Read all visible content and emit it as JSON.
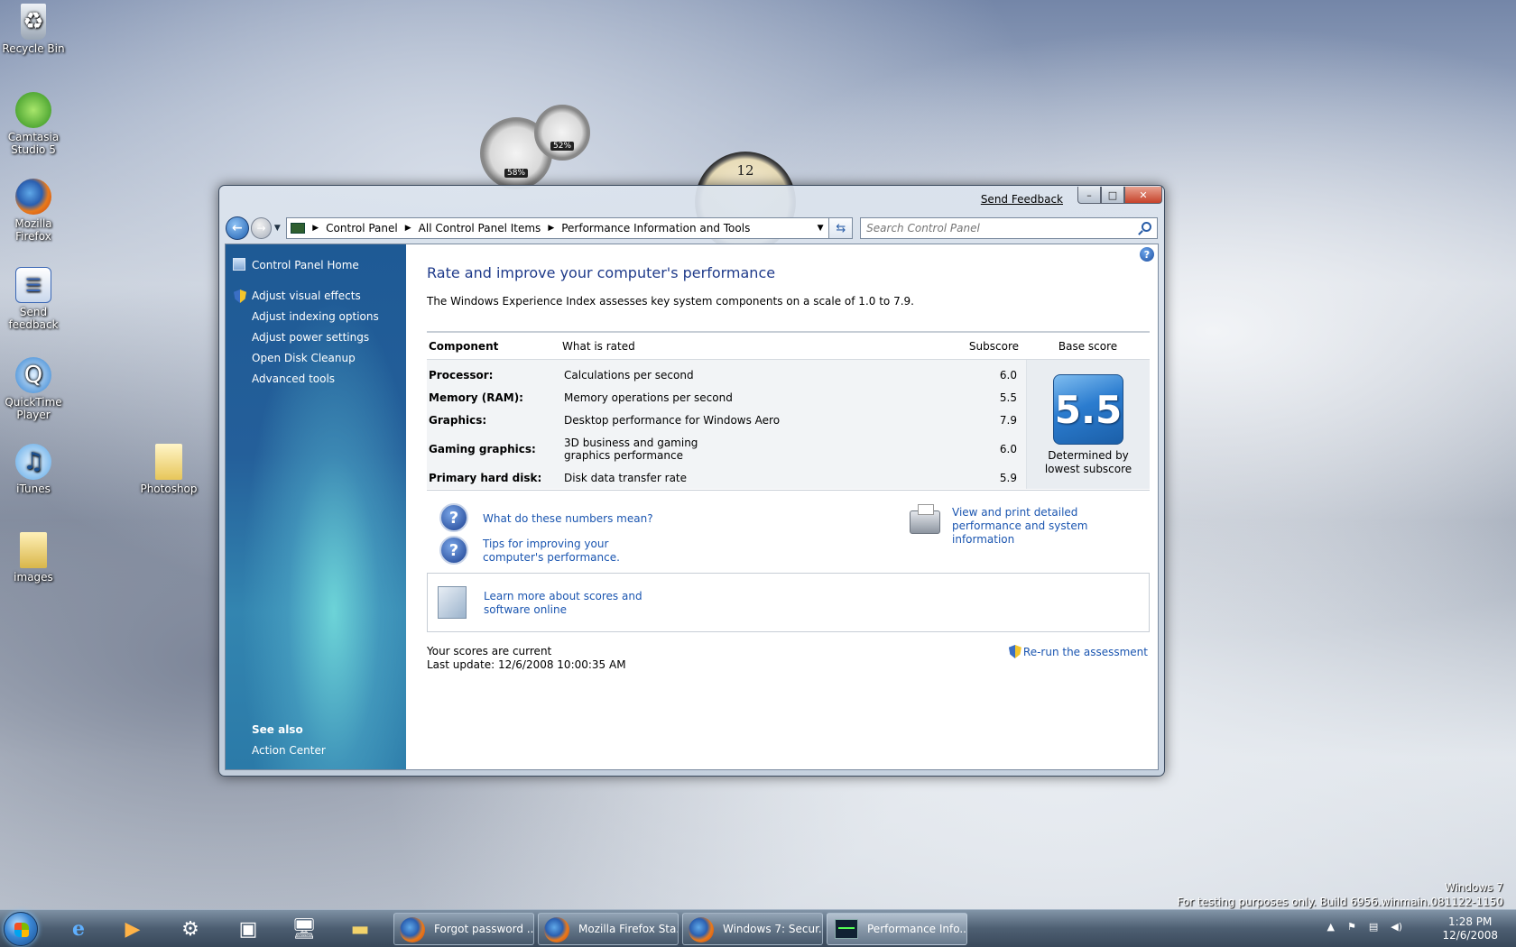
{
  "desktop": {
    "icons": [
      {
        "label": "Recycle Bin",
        "icon": "recycle-bin-icon"
      },
      {
        "label": "Camtasia Studio 5",
        "icon": "camtasia-icon"
      },
      {
        "label": "Mozilla Firefox",
        "icon": "firefox-icon"
      },
      {
        "label": "Send feedback",
        "icon": "feedback-icon"
      },
      {
        "label": "QuickTime Player",
        "icon": "quicktime-icon"
      },
      {
        "label": "iTunes",
        "icon": "itunes-icon"
      },
      {
        "label": "Photoshop",
        "icon": "folder-icon"
      },
      {
        "label": "images",
        "icon": "folder-icon"
      }
    ],
    "gadgets": {
      "cpu_meter_cpu": "58%",
      "cpu_meter_ram": "52%",
      "clock_twelve": "12"
    },
    "watermark": {
      "line1": "Windows 7",
      "line2": "For testing purposes only. Build 6956.winmain.081122-1150"
    }
  },
  "window": {
    "send_feedback": "Send Feedback",
    "controls": {
      "minimize": "–",
      "maximize": "□",
      "close": "✕"
    },
    "breadcrumb": [
      "Control Panel",
      "All Control Panel Items",
      "Performance Information and Tools"
    ],
    "search_placeholder": "Search Control Panel",
    "sidebar": {
      "home": "Control Panel Home",
      "tasks": [
        "Adjust visual effects",
        "Adjust indexing options",
        "Adjust power settings",
        "Open Disk Cleanup",
        "Advanced tools"
      ],
      "see_also": "See also",
      "action_center": "Action Center"
    },
    "content": {
      "title": "Rate and improve your computer's performance",
      "description": "The Windows Experience Index assesses key system components on a scale of 1.0 to 7.9.",
      "table": {
        "headers": {
          "component": "Component",
          "what": "What is rated",
          "subscore": "Subscore",
          "base": "Base score"
        },
        "rows": [
          {
            "component": "Processor:",
            "what": "Calculations per second",
            "subscore": "6.0"
          },
          {
            "component": "Memory (RAM):",
            "what": "Memory operations per second",
            "subscore": "5.5"
          },
          {
            "component": "Graphics:",
            "what": "Desktop performance for Windows Aero",
            "subscore": "7.9"
          },
          {
            "component": "Gaming graphics:",
            "what": "3D business and gaming graphics performance",
            "subscore": "6.0"
          },
          {
            "component": "Primary hard disk:",
            "what": "Disk data transfer rate",
            "subscore": "5.9"
          }
        ],
        "base_score": "5.5",
        "base_note_line1": "Determined by",
        "base_note_line2": "lowest subscore"
      },
      "links": {
        "numbers_mean": "What do these numbers mean?",
        "tips": "Tips for improving your computer's performance.",
        "view_print": "View and print detailed performance and system information",
        "learn_more": "Learn more about scores and software online",
        "rerun": "Re-run the assessment"
      },
      "status": {
        "current": "Your scores are current",
        "last_update": "Last update: 12/6/2008 10:00:35 AM"
      }
    }
  },
  "taskbar": {
    "tasks": [
      {
        "label": "Forgot password ...",
        "icon": "firefox-icon"
      },
      {
        "label": "Mozilla Firefox Sta...",
        "icon": "firefox-icon"
      },
      {
        "label": "Windows 7: Secur...",
        "icon": "firefox-icon"
      },
      {
        "label": "Performance Info...",
        "icon": "performance-icon",
        "active": true
      }
    ],
    "clock": {
      "time": "1:28 PM",
      "date": "12/6/2008"
    }
  }
}
